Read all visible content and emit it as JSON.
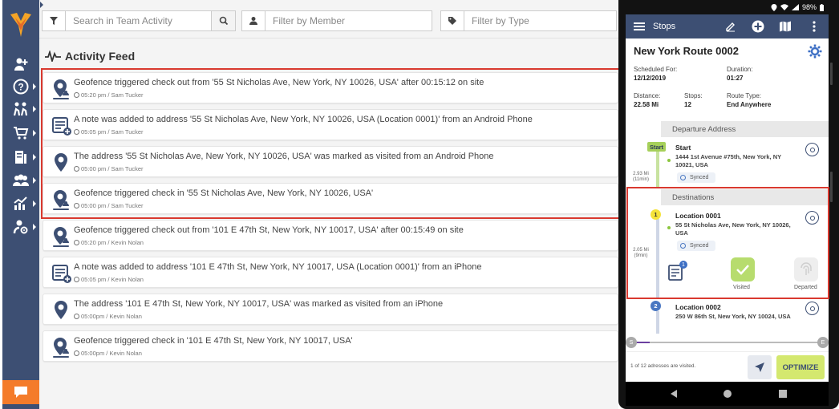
{
  "filters": {
    "search_placeholder": "Search in Team Activity",
    "member_placeholder": "Filter by Member",
    "type_placeholder": "Filter by Type"
  },
  "feed": {
    "title": "Activity Feed",
    "items": [
      {
        "icon": "geofence-pin-icon",
        "text": "Geofence triggered check out from '55 St Nicholas Ave, New York, NY 10026, USA' after 00:15:12 on site",
        "meta": "05:20 pm / Sam Tucker"
      },
      {
        "icon": "note-icon",
        "text": "A note was added to address '55 St Nicholas Ave, New York, NY 10026, USA (Location 0001)' from an Android Phone",
        "meta": "05:05 pm / Sam Tucker"
      },
      {
        "icon": "visited-pin-icon",
        "text": "The address '55 St Nicholas Ave, New York, NY 10026, USA' was marked as visited from an Android Phone",
        "meta": "05:00 pm / Sam Tucker"
      },
      {
        "icon": "geofence-pin-icon",
        "text": "Geofence triggered check in '55 St Nicholas Ave, New York, NY 10026, USA'",
        "meta": "05:00 pm / Sam Tucker"
      },
      {
        "icon": "geofence-pin-icon",
        "text": "Geofence triggered check out from '101 E 47th St, New York, NY 10017, USA' after 00:15:49 on site",
        "meta": "05:20 pm / Kevin Nolan"
      },
      {
        "icon": "note-icon",
        "text": "A note was added to address '101 E 47th St, New York, NY 10017, USA (Location 0001)' from an iPhone",
        "meta": "05:05 pm / Kevin Nolan"
      },
      {
        "icon": "visited-pin-icon",
        "text": "The address '101 E 47th St, New York, NY 10017, USA' was marked as visited from an iPhone",
        "meta": "05:00pm / Kevin Nolan"
      },
      {
        "icon": "geofence-pin-icon",
        "text": "Geofence triggered check in '101 E 47th St, New York, NY 10017, USA'",
        "meta": "05:00pm / Kevin Nolan"
      }
    ]
  },
  "phone": {
    "status": {
      "battery": "98%"
    },
    "appbar_title": "Stops",
    "route_name": "New York Route 0002",
    "scheduled_label": "Scheduled For:",
    "scheduled_value": "12/12/2019",
    "duration_label": "Duration:",
    "duration_value": "01:27",
    "distance_label": "Distance:",
    "distance_value": "22.58 Mi",
    "stops_label": "Stops:",
    "stops_value": "12",
    "route_type_label": "Route Type:",
    "route_type_value": "End Anywhere",
    "departure_header": "Departure Address",
    "start_badge": "Start",
    "start_name": "Start",
    "start_address": "1444 1st Avenue #75th, New York, NY 10021, USA",
    "synced": "Synced",
    "dist1": "2.93 Mi (11min)",
    "destinations_header": "Destinations",
    "stop1_number": "1",
    "stop1_name": "Location 0001",
    "stop1_address": "55 St Nicholas Ave, New York, NY 10026, USA",
    "dist2": "2.05 Mi (9min)",
    "note_count": "1",
    "visited_label": "Visited",
    "departed_label": "Departed",
    "stop2_number": "2",
    "stop2_name": "Location 0002",
    "stop2_address": "250 W 86th St, New York, NY 10024, USA",
    "progress_start": "S",
    "progress_end": "E",
    "visited_summary": "1 of 12 adresses are visited.",
    "optimize": "OPTIMIZE"
  },
  "colors": {
    "sidebar": "#3d4f73",
    "accent_orange": "#f47b2a",
    "highlight_red": "#d9392f",
    "visited_green": "#a6d05a",
    "optimize_bg": "#d4e86f"
  }
}
